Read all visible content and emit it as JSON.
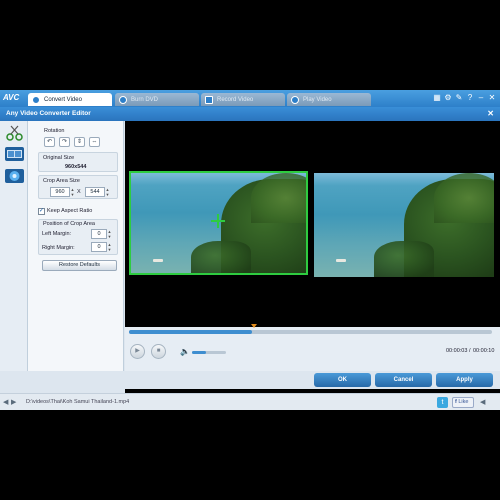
{
  "app": {
    "logo": "AVC",
    "tabs": [
      {
        "label": "Convert Video"
      },
      {
        "label": "Burn DVD"
      },
      {
        "label": "Record Video"
      },
      {
        "label": "Play Video"
      }
    ],
    "top_icons": [
      "grid-icon",
      "gear-icon",
      "tools-icon",
      "help-icon",
      "minimize-icon",
      "close-icon"
    ]
  },
  "editor": {
    "title": "Any Video Converter Editor",
    "close_glyph": "✕"
  },
  "settings": {
    "rotation_label": "Rotation",
    "original_size_label": "Original Size",
    "original_size_value": "960x544",
    "crop_area_label": "Crop Area Size",
    "crop_width": "960",
    "crop_x": "X",
    "crop_height": "544",
    "keep_aspect_label": "Keep Aspect Ratio",
    "keep_aspect_checked": true,
    "position_label": "Position of Crop Area",
    "left_margin_label": "Left Margin:",
    "left_margin_value": "0",
    "right_margin_label": "Right Margin:",
    "right_margin_value": "0",
    "restore_label": "Restore Defaults"
  },
  "player": {
    "progress": 0.34,
    "time_current": "00:00:03",
    "time_sep": "/",
    "time_total": "00:00:10"
  },
  "footer": {
    "ok_label": "OK",
    "cancel_label": "Cancel",
    "apply_label": "Apply"
  },
  "status": {
    "file_path": "D:\\videos\\Thai\\Koh Samui Thailand-1.mp4",
    "like_label": "Like"
  },
  "colors": {
    "accent": "#2d7fc9",
    "crop_border": "#2ecc40"
  }
}
